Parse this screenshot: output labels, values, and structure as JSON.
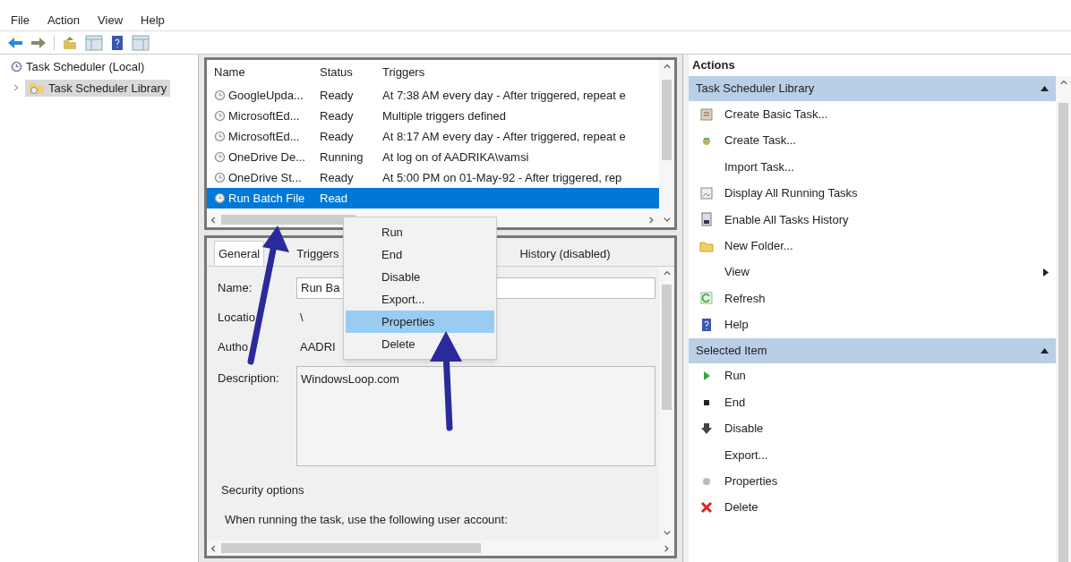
{
  "menu": [
    "File",
    "Action",
    "View",
    "Help"
  ],
  "tree": [
    {
      "label": "Task Scheduler (Local)",
      "selected": false,
      "children": [
        {
          "label": "Task Scheduler Library",
          "selected": true,
          "expanded": false
        }
      ]
    }
  ],
  "table": {
    "columns": [
      "Name",
      "Status",
      "Triggers"
    ],
    "rows": [
      {
        "name": "GoogleUpda...",
        "status": "Ready",
        "triggers": "At 7:38 AM every day - After triggered, repeat e",
        "selected": false
      },
      {
        "name": "MicrosoftEd...",
        "status": "Ready",
        "triggers": "Multiple triggers defined",
        "selected": false
      },
      {
        "name": "MicrosoftEd...",
        "status": "Ready",
        "triggers": "At 8:17 AM every day - After triggered, repeat e",
        "selected": false
      },
      {
        "name": "OneDrive De...",
        "status": "Running",
        "triggers": "At log on of AADRIKA\\vamsi",
        "selected": false
      },
      {
        "name": "OneDrive St...",
        "status": "Ready",
        "triggers": "At 5:00 PM on 01-May-92 - After triggered, rep",
        "selected": false
      },
      {
        "name": "Run Batch File",
        "status": "Read",
        "triggers": "",
        "selected": true
      }
    ]
  },
  "context_menu": [
    {
      "label": "Run",
      "selected": false
    },
    {
      "label": "End",
      "selected": false
    },
    {
      "label": "Disable",
      "selected": false
    },
    {
      "label": "Export...",
      "selected": false
    },
    {
      "label": "Properties",
      "selected": true
    },
    {
      "label": "Delete",
      "selected": false
    }
  ],
  "tabs": [
    {
      "label": "General",
      "selected": true
    },
    {
      "label": "Triggers",
      "selected": false
    },
    {
      "label": "History (disabled)",
      "selected": false
    }
  ],
  "details": {
    "fields": [
      {
        "label": "Name:",
        "value": "Run Ba"
      },
      {
        "label": "Locatio",
        "value": "\\"
      },
      {
        "label": "Autho",
        "value": "AADRI"
      }
    ],
    "description_label": "Description:",
    "description": "WindowsLoop.com",
    "security_title": "Security options",
    "security_text": "When running the task, use the following user account:"
  },
  "actions": {
    "title": "Actions",
    "sections": [
      {
        "title": "Task Scheduler Library",
        "expanded": true,
        "items": [
          {
            "label": "Create Basic Task...",
            "kind": "basic",
            "submenu": false
          },
          {
            "label": "Create Task...",
            "kind": "task",
            "submenu": false
          },
          {
            "label": "Import Task...",
            "kind": "plain",
            "submenu": false
          },
          {
            "label": "Display All Running Tasks",
            "kind": "display",
            "submenu": false
          },
          {
            "label": "Enable All Tasks History",
            "kind": "history",
            "submenu": false
          },
          {
            "label": "New Folder...",
            "kind": "folder",
            "submenu": false
          },
          {
            "label": "View",
            "kind": "plain",
            "submenu": true
          },
          {
            "label": "Refresh",
            "kind": "refresh",
            "submenu": false
          },
          {
            "label": "Help",
            "kind": "help",
            "submenu": false
          }
        ]
      },
      {
        "title": "Selected Item",
        "expanded": true,
        "items": [
          {
            "label": "Run",
            "kind": "run",
            "submenu": false
          },
          {
            "label": "End",
            "kind": "end",
            "submenu": false
          },
          {
            "label": "Disable",
            "kind": "disable",
            "submenu": false
          },
          {
            "label": "Export...",
            "kind": "plain",
            "submenu": false
          },
          {
            "label": "Properties",
            "kind": "props",
            "submenu": false
          },
          {
            "label": "Delete",
            "kind": "delete",
            "submenu": false
          }
        ]
      }
    ]
  }
}
